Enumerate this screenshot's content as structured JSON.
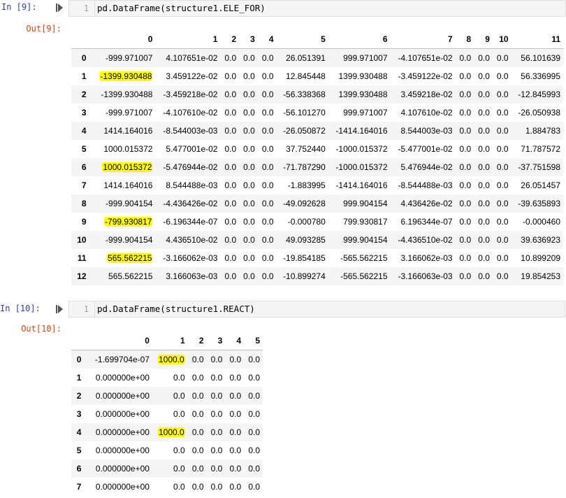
{
  "cell1": {
    "in_label": "In [9]:",
    "line_no": "1",
    "code": "pd.DataFrame(structure1.ELE_FOR)",
    "out_label": "Out[9]:",
    "columns": [
      "",
      "0",
      "1",
      "2",
      "3",
      "4",
      "5",
      "6",
      "7",
      "8",
      "9",
      "10",
      "11"
    ],
    "rows": [
      {
        "index": "0",
        "cells": [
          "-999.971007",
          "4.107651e-02",
          "0.0",
          "0.0",
          "0.0",
          "26.051391",
          "999.971007",
          "-4.107651e-02",
          "0.0",
          "0.0",
          "0.0",
          "56.101639"
        ]
      },
      {
        "index": "1",
        "cells": [
          "-1399.930488",
          "3.459122e-02",
          "0.0",
          "0.0",
          "0.0",
          "12.845448",
          "1399.930488",
          "-3.459122e-02",
          "0.0",
          "0.0",
          "0.0",
          "56.336995"
        ]
      },
      {
        "index": "2",
        "cells": [
          "-1399.930488",
          "-3.459218e-02",
          "0.0",
          "0.0",
          "0.0",
          "-56.338368",
          "1399.930488",
          "3.459218e-02",
          "0.0",
          "0.0",
          "0.0",
          "-12.845993"
        ]
      },
      {
        "index": "3",
        "cells": [
          "-999.971007",
          "-4.107610e-02",
          "0.0",
          "0.0",
          "0.0",
          "-56.101270",
          "999.971007",
          "4.107610e-02",
          "0.0",
          "0.0",
          "0.0",
          "-26.050938"
        ]
      },
      {
        "index": "4",
        "cells": [
          "1414.164016",
          "-8.544003e-03",
          "0.0",
          "0.0",
          "0.0",
          "-26.050872",
          "-1414.164016",
          "8.544003e-03",
          "0.0",
          "0.0",
          "0.0",
          "1.884783"
        ]
      },
      {
        "index": "5",
        "cells": [
          "1000.015372",
          "5.477001e-02",
          "0.0",
          "0.0",
          "0.0",
          "37.752440",
          "-1000.015372",
          "-5.477001e-02",
          "0.0",
          "0.0",
          "0.0",
          "71.787572"
        ]
      },
      {
        "index": "6",
        "cells": [
          "1000.015372",
          "-5.476944e-02",
          "0.0",
          "0.0",
          "0.0",
          "-71.787290",
          "-1000.015372",
          "5.476944e-02",
          "0.0",
          "0.0",
          "0.0",
          "-37.751598"
        ]
      },
      {
        "index": "7",
        "cells": [
          "1414.164016",
          "8.544488e-03",
          "0.0",
          "0.0",
          "0.0",
          "-1.883995",
          "-1414.164016",
          "-8.544488e-03",
          "0.0",
          "0.0",
          "0.0",
          "26.051457"
        ]
      },
      {
        "index": "8",
        "cells": [
          "-999.904154",
          "-4.436426e-02",
          "0.0",
          "0.0",
          "0.0",
          "-49.092628",
          "999.904154",
          "4.436426e-02",
          "0.0",
          "0.0",
          "0.0",
          "-39.635893"
        ]
      },
      {
        "index": "9",
        "cells": [
          "-799.930817",
          "-6.196344e-07",
          "0.0",
          "0.0",
          "0.0",
          "-0.000780",
          "799.930817",
          "6.196344e-07",
          "0.0",
          "0.0",
          "0.0",
          "-0.000460"
        ]
      },
      {
        "index": "10",
        "cells": [
          "-999.904154",
          "4.436510e-02",
          "0.0",
          "0.0",
          "0.0",
          "49.093285",
          "999.904154",
          "-4.436510e-02",
          "0.0",
          "0.0",
          "0.0",
          "39.636923"
        ]
      },
      {
        "index": "11",
        "cells": [
          "565.562215",
          "-3.166062e-03",
          "0.0",
          "0.0",
          "0.0",
          "-19.854185",
          "-565.562215",
          "3.166062e-03",
          "0.0",
          "0.0",
          "0.0",
          "10.899209"
        ]
      },
      {
        "index": "12",
        "cells": [
          "565.562215",
          "3.166063e-03",
          "0.0",
          "0.0",
          "0.0",
          "-10.899274",
          "-565.562215",
          "-3.166063e-03",
          "0.0",
          "0.0",
          "0.0",
          "19.854253"
        ]
      }
    ],
    "highlighted": [
      [
        1,
        0
      ],
      [
        6,
        0
      ],
      [
        9,
        0
      ],
      [
        11,
        0
      ]
    ]
  },
  "cell2": {
    "in_label": "In [10]:",
    "line_no": "1",
    "code": "pd.DataFrame(structure1.REACT)",
    "out_label": "Out[10]:",
    "columns": [
      "",
      "0",
      "1",
      "2",
      "3",
      "4",
      "5"
    ],
    "rows": [
      {
        "index": "0",
        "cells": [
          "-1.699704e-07",
          "1000.0",
          "0.0",
          "0.0",
          "0.0",
          "0.0"
        ]
      },
      {
        "index": "1",
        "cells": [
          "0.000000e+00",
          "0.0",
          "0.0",
          "0.0",
          "0.0",
          "0.0"
        ]
      },
      {
        "index": "2",
        "cells": [
          "0.000000e+00",
          "0.0",
          "0.0",
          "0.0",
          "0.0",
          "0.0"
        ]
      },
      {
        "index": "3",
        "cells": [
          "0.000000e+00",
          "0.0",
          "0.0",
          "0.0",
          "0.0",
          "0.0"
        ]
      },
      {
        "index": "4",
        "cells": [
          "0.000000e+00",
          "1000.0",
          "0.0",
          "0.0",
          "0.0",
          "0.0"
        ]
      },
      {
        "index": "5",
        "cells": [
          "0.000000e+00",
          "0.0",
          "0.0",
          "0.0",
          "0.0",
          "0.0"
        ]
      },
      {
        "index": "6",
        "cells": [
          "0.000000e+00",
          "0.0",
          "0.0",
          "0.0",
          "0.0",
          "0.0"
        ]
      },
      {
        "index": "7",
        "cells": [
          "0.000000e+00",
          "0.0",
          "0.0",
          "0.0",
          "0.0",
          "0.0"
        ]
      }
    ],
    "highlighted": [
      [
        0,
        1
      ],
      [
        4,
        1
      ]
    ]
  },
  "colors": {
    "in_prompt": "#303f9f",
    "out_prompt": "#d84315",
    "highlight": "#ffff00",
    "stripe": "#f5f5f5"
  },
  "icons": {
    "run": "run-cell-icon"
  }
}
